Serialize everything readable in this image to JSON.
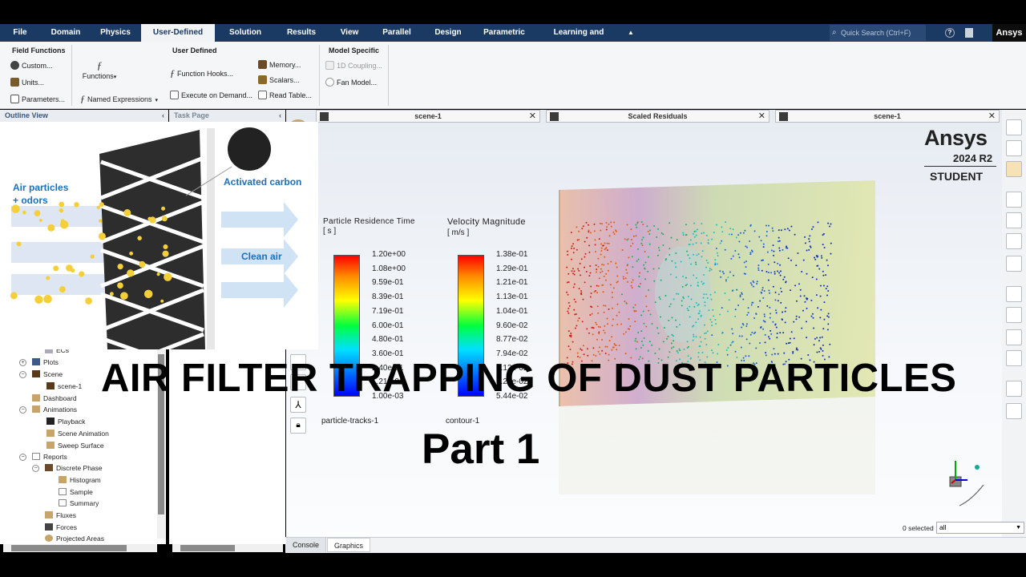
{
  "menubar": {
    "items": [
      "File",
      "Domain",
      "Physics",
      "User-Defined",
      "Solution",
      "Results",
      "View",
      "Parallel",
      "Design",
      "Parametric",
      "Learning and Support"
    ],
    "active": "User-Defined",
    "search_placeholder": "Quick Search (Ctrl+F)",
    "brand": "Ansys"
  },
  "ribbon": {
    "field_functions": {
      "title": "Field Functions",
      "custom": "Custom...",
      "units": "Units...",
      "parameters": "Parameters..."
    },
    "user_defined": {
      "title": "User Defined",
      "functions": "Functions",
      "function_hooks": "Function Hooks...",
      "execute_on_demand": "Execute on Demand...",
      "named_expressions": "Named Expressions",
      "memory": "Memory...",
      "scalars": "Scalars...",
      "read_table": "Read Table..."
    },
    "model_specific": {
      "title": "Model Specific",
      "coupling": "1D Coupling...",
      "fan_model": "Fan Model..."
    }
  },
  "panels": {
    "outline_view": "Outline View",
    "task_page": "Task Page"
  },
  "tree": [
    {
      "label": "ECs"
    },
    {
      "label": "Plots"
    },
    {
      "label": "Scene"
    },
    {
      "label": "scene-1"
    },
    {
      "label": "Dashboard"
    },
    {
      "label": "Animations"
    },
    {
      "label": "Playback"
    },
    {
      "label": "Scene Animation"
    },
    {
      "label": "Sweep Surface"
    },
    {
      "label": "Reports"
    },
    {
      "label": "Discrete Phase"
    },
    {
      "label": "Histogram"
    },
    {
      "label": "Sample"
    },
    {
      "label": "Summary"
    },
    {
      "label": "Fluxes"
    },
    {
      "label": "Forces"
    },
    {
      "label": "Projected Areas"
    }
  ],
  "tabs": [
    {
      "label": "scene-1"
    },
    {
      "label": "Scaled Residuals"
    },
    {
      "label": "scene-1"
    }
  ],
  "watermark": {
    "brand": "Ansys",
    "version": "2024 R2",
    "edition": "STUDENT"
  },
  "legend_residence": {
    "title": "Particle Residence Time",
    "unit": "[ s ]",
    "values": [
      "1.20e+00",
      "1.08e+00",
      "9.59e-01",
      "8.39e-01",
      "7.19e-01",
      "6.00e-01",
      "4.80e-01",
      "3.60e-01",
      "2.40e-01",
      "1.21e-01",
      "1.00e-03"
    ],
    "caption": "particle-tracks-1"
  },
  "legend_velocity": {
    "title": "Velocity Magnitude",
    "unit": "[ m/s ]",
    "values": [
      "1.38e-01",
      "1.29e-01",
      "1.21e-01",
      "1.13e-01",
      "1.04e-01",
      "9.60e-02",
      "8.77e-02",
      "7.94e-02",
      "7.12e-02",
      "6.29e-02",
      "5.44e-02"
    ],
    "caption": "contour-1"
  },
  "illustration": {
    "air_particles": "Air particles",
    "odors": "+ odors",
    "activated_carbon": "Activated carbon",
    "clean_air": "Clean air"
  },
  "overlay": {
    "title": "AIR FILTER TRAPPING OF DUST PARTICLES",
    "subtitle": "Part 1"
  },
  "bottom": {
    "console": "Console",
    "graphics": "Graphics",
    "selected": "0 selected",
    "filter": "all"
  },
  "colors": {
    "menubar": "#1b3a63",
    "accent": "#f2f3f5"
  }
}
